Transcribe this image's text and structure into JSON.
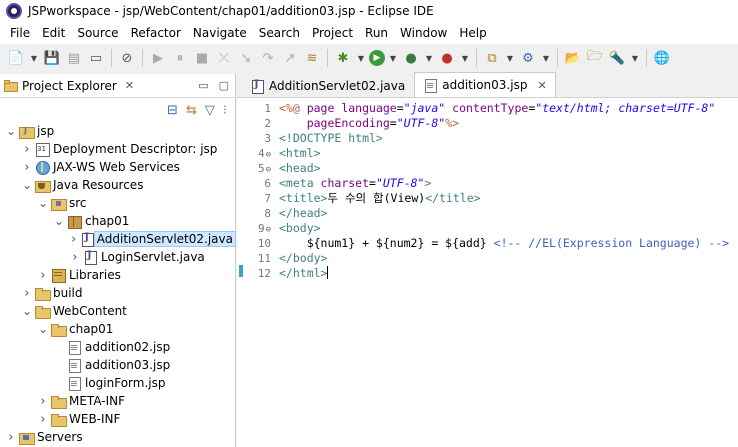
{
  "window": {
    "title": "JSPworkspace - jsp/WebContent/chap01/addition03.jsp - Eclipse IDE"
  },
  "menubar": {
    "items": [
      "File",
      "Edit",
      "Source",
      "Refactor",
      "Navigate",
      "Search",
      "Project",
      "Run",
      "Window",
      "Help"
    ]
  },
  "explorer": {
    "tab_label": "Project Explorer",
    "tab_close": "✕",
    "minimize": "▭",
    "maximize": "▢",
    "tree": [
      {
        "label": "jsp",
        "level": 0,
        "chevron": "expanded",
        "icon": "project"
      },
      {
        "label": "Deployment Descriptor: jsp",
        "level": 1,
        "chevron": "collapsed",
        "icon": "descriptor"
      },
      {
        "label": "JAX-WS Web Services",
        "level": 1,
        "chevron": "collapsed",
        "icon": "globe"
      },
      {
        "label": "Java Resources",
        "level": 1,
        "chevron": "expanded",
        "icon": "javares"
      },
      {
        "label": "src",
        "level": 2,
        "chevron": "expanded",
        "icon": "srcfolder"
      },
      {
        "label": "chap01",
        "level": 3,
        "chevron": "expanded",
        "icon": "package"
      },
      {
        "label": "AdditionServlet02.java",
        "level": 4,
        "chevron": "collapsed",
        "icon": "java",
        "selected": true
      },
      {
        "label": "LoginServlet.java",
        "level": 4,
        "chevron": "collapsed",
        "icon": "java"
      },
      {
        "label": "Libraries",
        "level": 2,
        "chevron": "collapsed",
        "icon": "libraries"
      },
      {
        "label": "build",
        "level": 1,
        "chevron": "collapsed",
        "icon": "folder"
      },
      {
        "label": "WebContent",
        "level": 1,
        "chevron": "expanded",
        "icon": "folder"
      },
      {
        "label": "chap01",
        "level": 2,
        "chevron": "expanded",
        "icon": "folder"
      },
      {
        "label": "addition02.jsp",
        "level": 3,
        "chevron": "none",
        "icon": "file"
      },
      {
        "label": "addition03.jsp",
        "level": 3,
        "chevron": "none",
        "icon": "file"
      },
      {
        "label": "loginForm.jsp",
        "level": 3,
        "chevron": "none",
        "icon": "file"
      },
      {
        "label": "META-INF",
        "level": 2,
        "chevron": "collapsed",
        "icon": "folder"
      },
      {
        "label": "WEB-INF",
        "level": 2,
        "chevron": "collapsed",
        "icon": "folder"
      },
      {
        "label": "Servers",
        "level": 0,
        "chevron": "collapsed",
        "icon": "servers"
      }
    ]
  },
  "editor": {
    "tabs": [
      {
        "label": "AdditionServlet02.java",
        "icon": "java",
        "active": false
      },
      {
        "label": "addition03.jsp",
        "icon": "file",
        "active": true,
        "close": "✕"
      }
    ],
    "lines": [
      {
        "num": "1",
        "fold": "",
        "tokens": [
          [
            "t-dir",
            "<%@ "
          ],
          [
            "t-attr",
            "page "
          ],
          [
            "t-attr",
            "language"
          ],
          [
            "t-text",
            "="
          ],
          [
            "t-str",
            "\"java\""
          ],
          [
            "t-text",
            " "
          ],
          [
            "t-attr",
            "contentType"
          ],
          [
            "t-text",
            "="
          ],
          [
            "t-str",
            "\"text/html; charset=UTF-8\""
          ]
        ]
      },
      {
        "num": "2",
        "fold": "",
        "tokens": [
          [
            "t-text",
            "    "
          ],
          [
            "t-attr",
            "pageEncoding"
          ],
          [
            "t-text",
            "="
          ],
          [
            "t-str",
            "\"UTF-8\""
          ],
          [
            "t-dir",
            "%>"
          ]
        ]
      },
      {
        "num": "3",
        "fold": "",
        "tokens": [
          [
            "t-tag",
            "<!DOCTYPE html>"
          ]
        ]
      },
      {
        "num": "4",
        "fold": "⊖",
        "tokens": [
          [
            "t-tag",
            "<html>"
          ]
        ]
      },
      {
        "num": "5",
        "fold": "⊖",
        "tokens": [
          [
            "t-tag",
            "<head>"
          ]
        ]
      },
      {
        "num": "6",
        "fold": "",
        "tokens": [
          [
            "t-tag",
            "<meta "
          ],
          [
            "t-attr",
            "charset"
          ],
          [
            "t-text",
            "="
          ],
          [
            "t-str",
            "\"UTF-8\""
          ],
          [
            "t-tag",
            ">"
          ]
        ]
      },
      {
        "num": "7",
        "fold": "",
        "tokens": [
          [
            "t-tag",
            "<title>"
          ],
          [
            "t-el",
            "두 수의 합(View)"
          ],
          [
            "t-tag",
            "</title>"
          ]
        ]
      },
      {
        "num": "8",
        "fold": "",
        "tokens": [
          [
            "t-tag",
            "</head>"
          ]
        ]
      },
      {
        "num": "9",
        "fold": "⊖",
        "tokens": [
          [
            "t-tag",
            "<body>"
          ]
        ]
      },
      {
        "num": "10",
        "fold": "",
        "tokens": [
          [
            "t-el",
            "    ${num1} + ${num2} = ${add} "
          ],
          [
            "t-cmt",
            "<!-- //EL(Expression Language) -->"
          ]
        ]
      },
      {
        "num": "11",
        "fold": "",
        "tokens": [
          [
            "t-tag",
            "</body>"
          ]
        ]
      },
      {
        "num": "12",
        "fold": "",
        "current": true,
        "tokens": [
          [
            "t-tag",
            "</html>"
          ]
        ]
      }
    ]
  }
}
